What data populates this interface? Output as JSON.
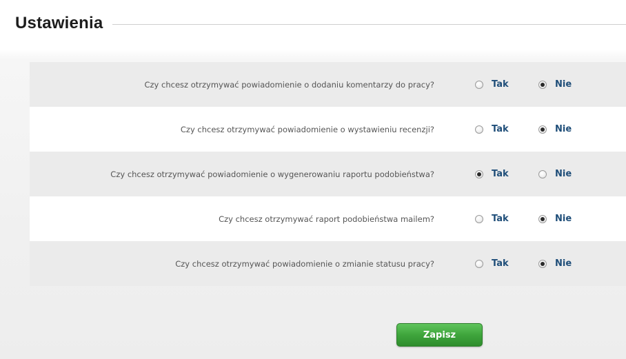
{
  "header": {
    "title": "Ustawienia"
  },
  "settings": {
    "rows": [
      {
        "question": "Czy chcesz otrzymywać powiadomienie o dodaniu komentarzy do pracy?",
        "tak_label": "Tak",
        "nie_label": "Nie",
        "selected": "Nie"
      },
      {
        "question": "Czy chcesz otrzymywać powiadomienie o wystawieniu recenzji?",
        "tak_label": "Tak",
        "nie_label": "Nie",
        "selected": "Nie"
      },
      {
        "question": "Czy chcesz otrzymywać powiadomienie o wygenerowaniu raportu podobieństwa?",
        "tak_label": "Tak",
        "nie_label": "Nie",
        "selected": "Tak"
      },
      {
        "question": "Czy chcesz otrzymywać raport podobieństwa mailem?",
        "tak_label": "Tak",
        "nie_label": "Nie",
        "selected": "Nie"
      },
      {
        "question": "Czy chcesz otrzymywać powiadomienie o zmianie statusu pracy?",
        "tak_label": "Tak",
        "nie_label": "Nie",
        "selected": "Nie"
      }
    ]
  },
  "actions": {
    "save_label": "Zapisz"
  },
  "colors": {
    "accent_green": "#3fa53c",
    "label_blue": "#1f4e79",
    "row_stripe": "#ebebeb"
  }
}
